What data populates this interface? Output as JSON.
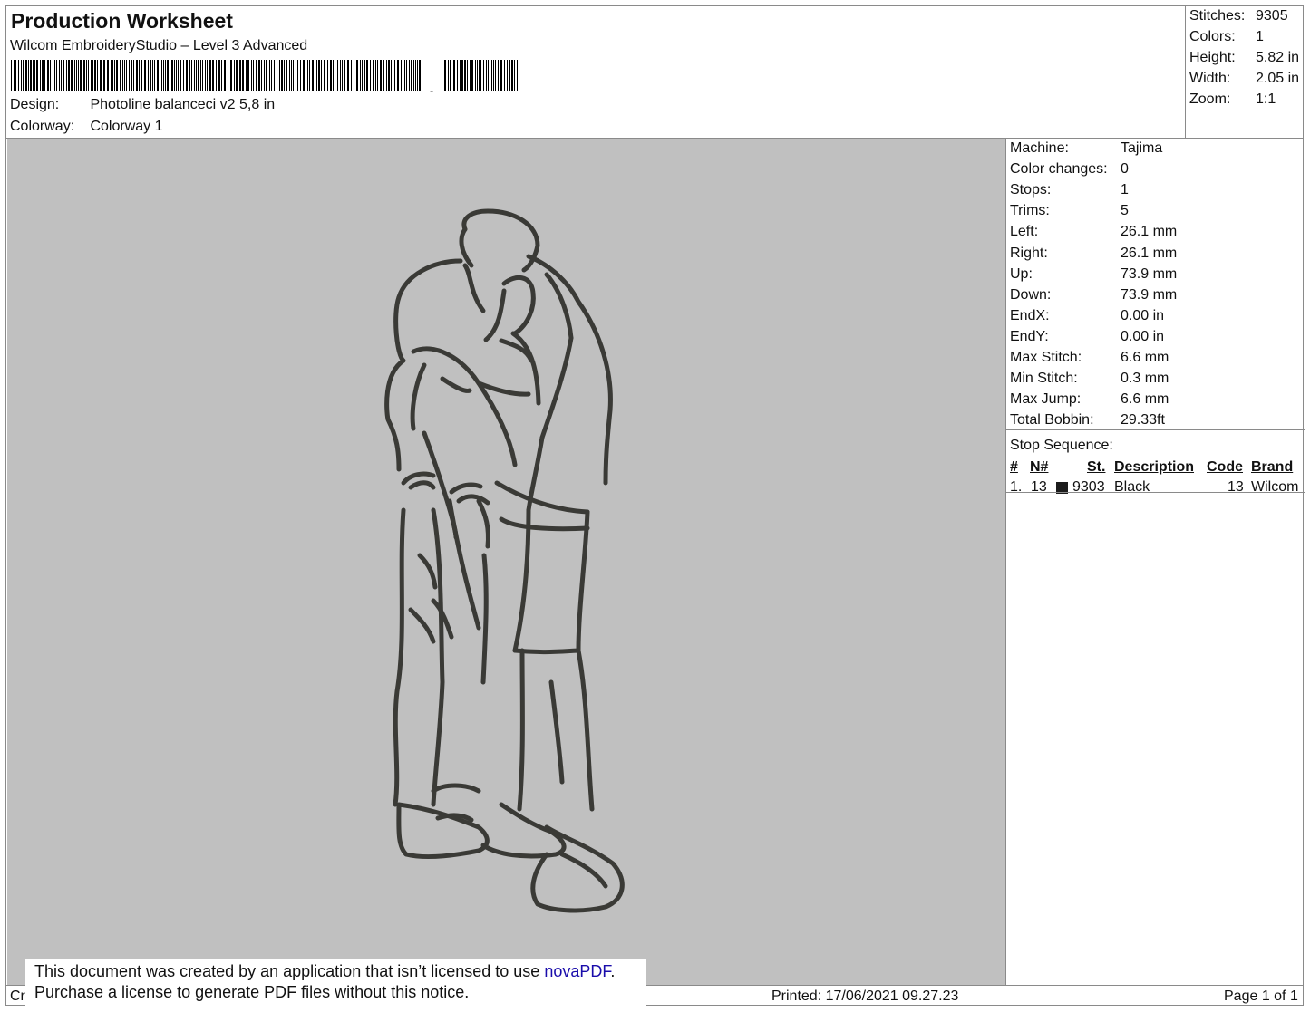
{
  "header": {
    "title": "Production Worksheet",
    "subtitle": "Wilcom EmbroideryStudio – Level 3 Advanced",
    "barcode_suffix": ",",
    "design_label": "Design:",
    "design_value": "Photoline balanceci v2 5,8 in",
    "colorway_label": "Colorway:",
    "colorway_value": "Colorway 1"
  },
  "summary": [
    {
      "label": "Stitches:",
      "value": "9305"
    },
    {
      "label": "Colors:",
      "value": "1"
    },
    {
      "label": "Height:",
      "value": "5.82 in"
    },
    {
      "label": "Width:",
      "value": "2.05 in"
    },
    {
      "label": "Zoom:",
      "value": "1:1"
    }
  ],
  "stats": [
    {
      "label": "Machine:",
      "value": "Tajima"
    },
    {
      "label": "Color changes:",
      "value": "0"
    },
    {
      "label": "Stops:",
      "value": "1"
    },
    {
      "label": "Trims:",
      "value": "5"
    },
    {
      "label": "Left:",
      "value": "26.1 mm"
    },
    {
      "label": "Right:",
      "value": "26.1 mm"
    },
    {
      "label": "Up:",
      "value": "73.9 mm"
    },
    {
      "label": "Down:",
      "value": "73.9 mm"
    },
    {
      "label": "EndX:",
      "value": "0.00 in"
    },
    {
      "label": "EndY:",
      "value": "0.00 in"
    },
    {
      "label": "Max Stitch:",
      "value": "6.6 mm"
    },
    {
      "label": "Min Stitch:",
      "value": "0.3 mm"
    },
    {
      "label": "Max Jump:",
      "value": "6.6 mm"
    },
    {
      "label": "Total Bobbin:",
      "value": "29.33ft"
    }
  ],
  "stop_sequence": {
    "title": "Stop Sequence:",
    "headers": {
      "num": "#",
      "needle": "N#",
      "st": "St.",
      "description": "Description",
      "code": "Code",
      "brand": "Brand"
    },
    "rows": [
      {
        "num": "1.",
        "needle": "13",
        "swatch_color": "#1c1c1c",
        "st": "9303",
        "description": "Black",
        "code": "13",
        "brand": "Wilcom"
      }
    ]
  },
  "preview": {
    "background": "#c0c0c0",
    "stitch_color": "#3a3a36"
  },
  "footer": {
    "left": "Cr",
    "printed": "Printed: 17/06/2021 09.27.23",
    "page": "Page 1 of 1"
  },
  "notice": {
    "line1_prefix": "This document was created by an application that isn’t licensed to use ",
    "link": "novaPDF",
    "line1_suffix": ".",
    "line2": "Purchase a license to generate PDF files without this notice."
  }
}
